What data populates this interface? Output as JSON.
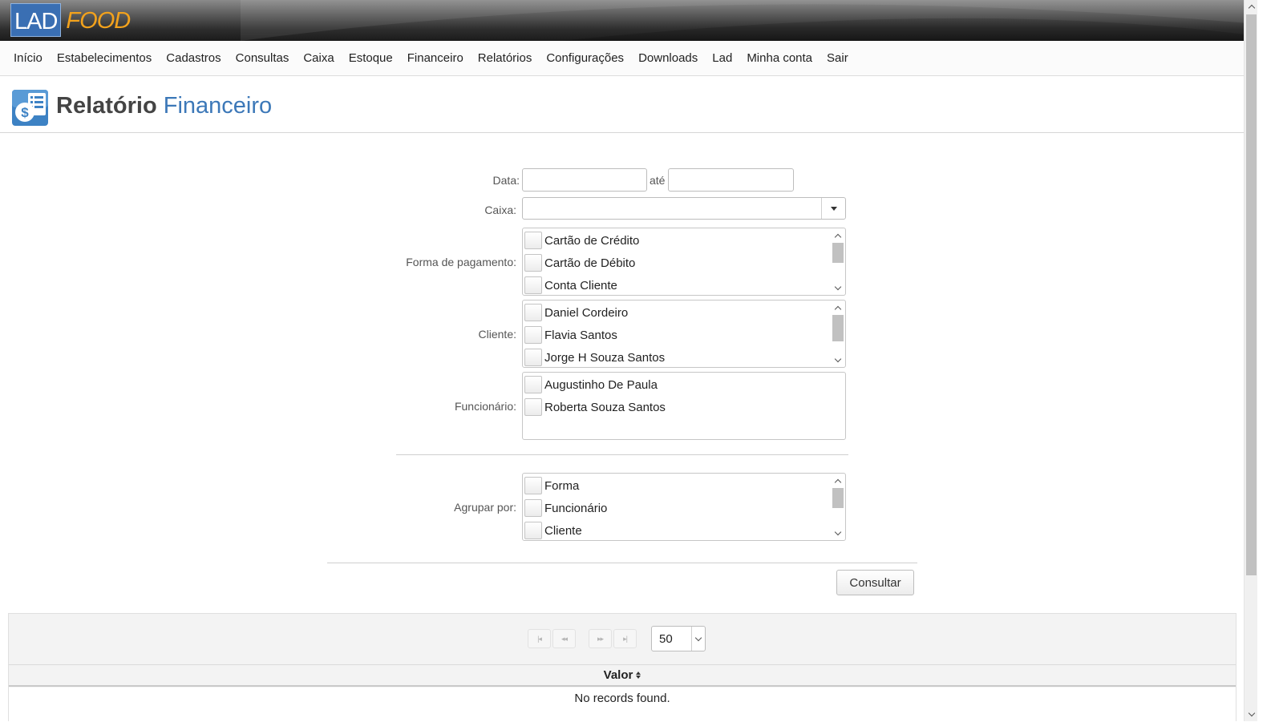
{
  "header": {
    "logo_part1": "LAD",
    "logo_part2": "FOOD",
    "logo_colors": {
      "lad_bg": "#3a6fb3",
      "food": "#f3a21c"
    }
  },
  "menu": {
    "items": [
      "Início",
      "Estabelecimentos",
      "Cadastros",
      "Consultas",
      "Caixa",
      "Estoque",
      "Financeiro",
      "Relatórios",
      "Configurações",
      "Downloads",
      "Lad",
      "Minha conta",
      "Sair"
    ]
  },
  "page": {
    "title_main": "Relatório",
    "title_accent": "Financeiro",
    "title_icon": "money-report-icon",
    "accent_color": "#3c78b8"
  },
  "form": {
    "data_label": "Data:",
    "ate_label": "até",
    "data_from_value": "",
    "data_to_value": "",
    "caixa_label": "Caixa:",
    "caixa_value": "",
    "forma_label": "Forma de pagamento:",
    "forma_items": [
      "Cartão de Crédito",
      "Cartão de Débito",
      "Conta Cliente"
    ],
    "cliente_label": "Cliente:",
    "cliente_items": [
      "Daniel Cordeiro",
      "Flavia Santos",
      "Jorge H Souza Santos"
    ],
    "funcionario_label": "Funcionário:",
    "funcionario_items": [
      "Augustinho De Paula",
      "Roberta Souza Santos"
    ],
    "agrupar_label": "Agrupar por:",
    "agrupar_items": [
      "Forma",
      "Funcionário",
      "Cliente"
    ],
    "submit_label": "Consultar"
  },
  "table": {
    "paginator": {
      "first": "|◂",
      "prev": "◂◂",
      "next": "▸▸",
      "last": "▸|",
      "rows_per_page": "50"
    },
    "columns": [
      "Valor"
    ],
    "empty_message": "No records found."
  }
}
